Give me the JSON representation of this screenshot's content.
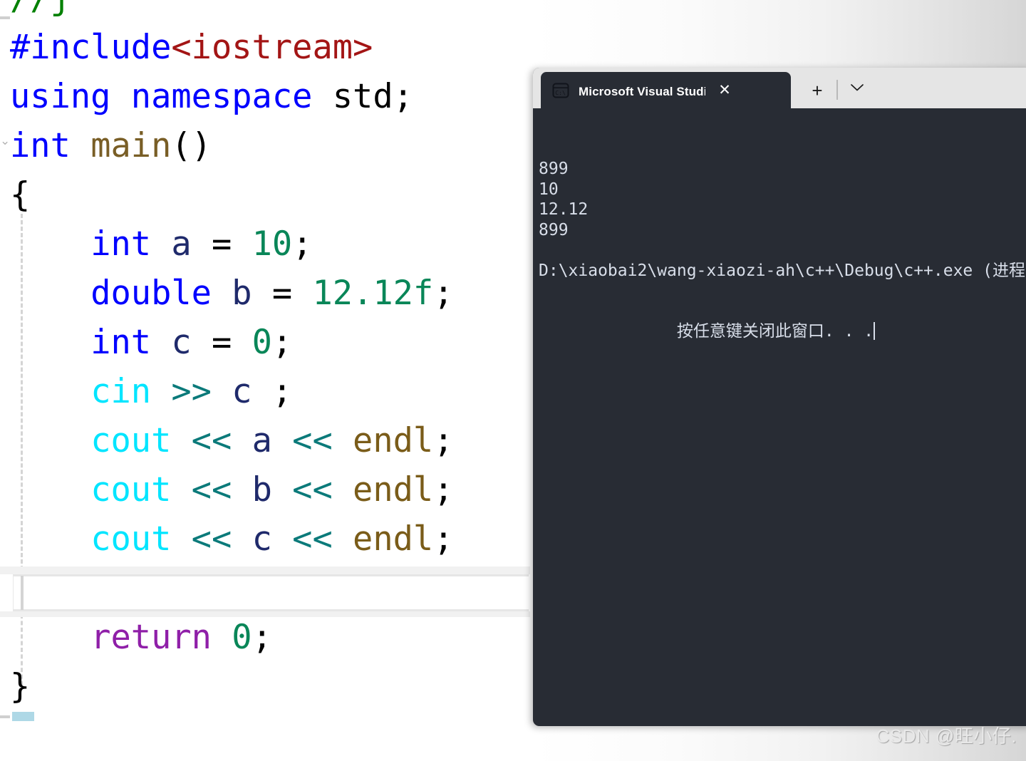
{
  "editor": {
    "name": "visual-studio-code-editor",
    "background": "#ffffff",
    "font_size_px": 47,
    "current_line_index": 11,
    "colors": {
      "comment": "#008000",
      "preprocessor": "#0000ff",
      "header_string": "#a31515",
      "keyword": "#0000ff",
      "function": "#795e26",
      "variable": "#1f2a6b",
      "number": "#098658",
      "stream_object": "#00e5ff",
      "stream_operator": "#0b7a7a",
      "manipulator": "#7a5c19",
      "return_keyword": "#8f1fa8",
      "plain": "#000000",
      "current_line_border": "#e6e6e6",
      "indent_guide": "#d4d4d4",
      "selection": "#aed8e6"
    },
    "lines": [
      {
        "id": "line-comment",
        "tokens": [
          {
            "cls": "t-comment",
            "text": "//j"
          }
        ]
      },
      {
        "id": "line-include",
        "tokens": [
          {
            "cls": "t-pp",
            "text": "#include"
          },
          {
            "cls": "t-header",
            "text": "<iostream>"
          }
        ]
      },
      {
        "id": "line-using",
        "tokens": [
          {
            "cls": "t-kw",
            "text": "using namespace "
          },
          {
            "cls": "t-plain",
            "text": "std;"
          }
        ]
      },
      {
        "id": "line-main",
        "tokens": [
          {
            "cls": "t-kw",
            "text": "int "
          },
          {
            "cls": "t-fn",
            "text": "main"
          },
          {
            "cls": "t-plain",
            "text": "()"
          }
        ]
      },
      {
        "id": "line-open-brace",
        "tokens": [
          {
            "cls": "t-brace",
            "text": "{"
          }
        ]
      },
      {
        "id": "line-decl-a",
        "tokens": [
          {
            "cls": "t-plain",
            "text": "    "
          },
          {
            "cls": "t-kw",
            "text": "int"
          },
          {
            "cls": "t-plain",
            "text": " "
          },
          {
            "cls": "t-var",
            "text": "a"
          },
          {
            "cls": "t-plain",
            "text": " = "
          },
          {
            "cls": "t-num",
            "text": "10"
          },
          {
            "cls": "t-plain",
            "text": ";"
          }
        ]
      },
      {
        "id": "line-decl-b",
        "tokens": [
          {
            "cls": "t-plain",
            "text": "    "
          },
          {
            "cls": "t-kw",
            "text": "double"
          },
          {
            "cls": "t-plain",
            "text": " "
          },
          {
            "cls": "t-var",
            "text": "b"
          },
          {
            "cls": "t-plain",
            "text": " = "
          },
          {
            "cls": "t-num",
            "text": "12.12f"
          },
          {
            "cls": "t-plain",
            "text": ";"
          }
        ]
      },
      {
        "id": "line-decl-c",
        "tokens": [
          {
            "cls": "t-plain",
            "text": "    "
          },
          {
            "cls": "t-kw",
            "text": "int"
          },
          {
            "cls": "t-plain",
            "text": " "
          },
          {
            "cls": "t-var",
            "text": "c"
          },
          {
            "cls": "t-plain",
            "text": " = "
          },
          {
            "cls": "t-num",
            "text": "0"
          },
          {
            "cls": "t-plain",
            "text": ";"
          }
        ]
      },
      {
        "id": "line-cin-c",
        "tokens": [
          {
            "cls": "t-plain",
            "text": "    "
          },
          {
            "cls": "t-stream",
            "text": "cin"
          },
          {
            "cls": "t-plain",
            "text": " "
          },
          {
            "cls": "t-op",
            "text": ">>"
          },
          {
            "cls": "t-plain",
            "text": " "
          },
          {
            "cls": "t-var",
            "text": "c"
          },
          {
            "cls": "t-plain",
            "text": " ;"
          }
        ]
      },
      {
        "id": "line-cout-a",
        "tokens": [
          {
            "cls": "t-plain",
            "text": "    "
          },
          {
            "cls": "t-stream",
            "text": "cout"
          },
          {
            "cls": "t-plain",
            "text": " "
          },
          {
            "cls": "t-op",
            "text": "<<"
          },
          {
            "cls": "t-plain",
            "text": " "
          },
          {
            "cls": "t-var",
            "text": "a"
          },
          {
            "cls": "t-plain",
            "text": " "
          },
          {
            "cls": "t-op",
            "text": "<<"
          },
          {
            "cls": "t-plain",
            "text": " "
          },
          {
            "cls": "t-manip",
            "text": "endl"
          },
          {
            "cls": "t-plain",
            "text": ";"
          }
        ]
      },
      {
        "id": "line-cout-b",
        "tokens": [
          {
            "cls": "t-plain",
            "text": "    "
          },
          {
            "cls": "t-stream",
            "text": "cout"
          },
          {
            "cls": "t-plain",
            "text": " "
          },
          {
            "cls": "t-op",
            "text": "<<"
          },
          {
            "cls": "t-plain",
            "text": " "
          },
          {
            "cls": "t-var",
            "text": "b"
          },
          {
            "cls": "t-plain",
            "text": " "
          },
          {
            "cls": "t-op",
            "text": "<<"
          },
          {
            "cls": "t-plain",
            "text": " "
          },
          {
            "cls": "t-manip",
            "text": "endl"
          },
          {
            "cls": "t-plain",
            "text": ";"
          }
        ]
      },
      {
        "id": "line-cout-c",
        "tokens": [
          {
            "cls": "t-plain",
            "text": "    "
          },
          {
            "cls": "t-stream",
            "text": "cout"
          },
          {
            "cls": "t-plain",
            "text": " "
          },
          {
            "cls": "t-op",
            "text": "<<"
          },
          {
            "cls": "t-plain",
            "text": " "
          },
          {
            "cls": "t-var",
            "text": "c"
          },
          {
            "cls": "t-plain",
            "text": " "
          },
          {
            "cls": "t-op",
            "text": "<<"
          },
          {
            "cls": "t-plain",
            "text": " "
          },
          {
            "cls": "t-manip",
            "text": "endl"
          },
          {
            "cls": "t-plain",
            "text": ";"
          }
        ]
      },
      {
        "id": "line-empty-current",
        "tokens": [
          {
            "cls": "t-plain",
            "text": ""
          }
        ]
      },
      {
        "id": "line-return",
        "tokens": [
          {
            "cls": "t-plain",
            "text": "    "
          },
          {
            "cls": "t-ret",
            "text": "return"
          },
          {
            "cls": "t-plain",
            "text": " "
          },
          {
            "cls": "t-num",
            "text": "0"
          },
          {
            "cls": "t-plain",
            "text": ";"
          }
        ]
      },
      {
        "id": "line-close-brace",
        "tokens": [
          {
            "cls": "t-brace",
            "text": "}"
          }
        ]
      }
    ],
    "fold_chevron_glyph": "⌄"
  },
  "console": {
    "window_name": "visual-studio-debug-console",
    "background": "#282c34",
    "tab_strip_background": "#e5e5e5",
    "tab": {
      "title": "Microsoft Visual Studio 调试控",
      "icon": "console-terminal-icon",
      "close_label": "✕",
      "new_tab_label": "+",
      "dropdown_label": "⌄"
    },
    "output_lines": [
      "899",
      "10",
      "12.12",
      "899",
      "",
      "D:\\xiaobai2\\wang-xiaozi-ah\\c++\\Debug\\c++.exe (进程"
    ],
    "prompt_line": "按任意键关闭此窗口. . .",
    "text_color": "#d8dee9"
  },
  "watermark": {
    "text": "CSDN @旺小仔."
  }
}
